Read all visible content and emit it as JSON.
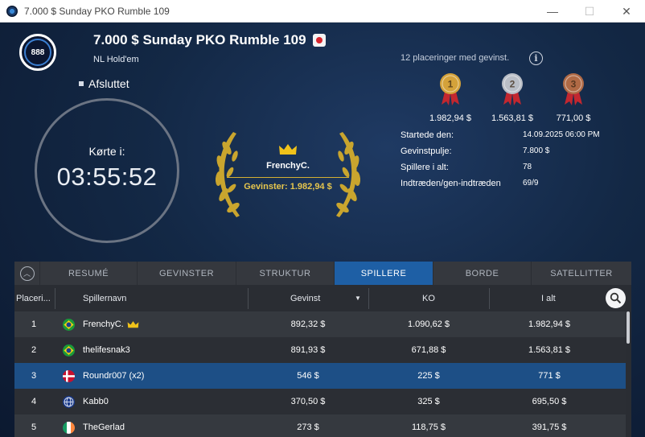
{
  "window": {
    "title": "7.000 $ Sunday PKO Rumble 109",
    "minimize": "—",
    "maximize": "☐",
    "close": "✕"
  },
  "tournament": {
    "logo_text": "888",
    "name": "7.000 $ Sunday PKO Rumble 109",
    "game_type": "NL Hold'em",
    "status": "Afsluttet"
  },
  "clock": {
    "label": "Kørte i:",
    "time": "03:55:52"
  },
  "winner": {
    "name": "FrenchyC.",
    "prize": "Gevinster: 1.982,94 $"
  },
  "payouts": {
    "header": "12 placeringer med gevinst.",
    "medals": [
      {
        "place": "1",
        "amount": "1.982,94 $",
        "color": "#d4a23a"
      },
      {
        "place": "2",
        "amount": "1.563,81 $",
        "color": "#b9bec6"
      },
      {
        "place": "3",
        "amount": "771,00 $",
        "color": "#b06a45"
      }
    ]
  },
  "stats": [
    {
      "label": "Startede den:",
      "value": "14.09.2025   06:00 PM"
    },
    {
      "label": "Gevinstpulje:",
      "value": "7.800 $"
    },
    {
      "label": "Spillere i alt:",
      "value": "78"
    },
    {
      "label": "Indtræden/gen-indtræden",
      "value": "69/9"
    }
  ],
  "tabs": [
    {
      "label": "RESUMÉ",
      "active": false
    },
    {
      "label": "GEVINSTER",
      "active": false
    },
    {
      "label": "STRUKTUR",
      "active": false
    },
    {
      "label": "SPILLERE",
      "active": true
    },
    {
      "label": "BORDE",
      "active": false
    },
    {
      "label": "SATELLITTER",
      "active": false
    }
  ],
  "table": {
    "headers": {
      "place": "Placeri...",
      "player": "Spillernavn",
      "winnings": "Gevinst",
      "sort_arrow": "▼",
      "ko": "KO",
      "total": "I alt"
    },
    "rows": [
      {
        "place": "1",
        "flag": "brazil",
        "name": "FrenchyC.",
        "crown": true,
        "winnings": "892,32 $",
        "ko": "1.090,62 $",
        "total": "1.982,94 $",
        "selected": false
      },
      {
        "place": "2",
        "flag": "brazil",
        "name": "thelifesnak3",
        "crown": false,
        "winnings": "891,93 $",
        "ko": "671,88 $",
        "total": "1.563,81 $",
        "selected": false
      },
      {
        "place": "3",
        "flag": "denmark",
        "name": "Roundr007 (x2)",
        "crown": false,
        "winnings": "546 $",
        "ko": "225 $",
        "total": "771 $",
        "selected": true
      },
      {
        "place": "4",
        "flag": "globe",
        "name": "Kabb0",
        "crown": false,
        "winnings": "370,50 $",
        "ko": "325 $",
        "total": "695,50 $",
        "selected": false
      },
      {
        "place": "5",
        "flag": "ireland",
        "name": "TheGerlad",
        "crown": false,
        "winnings": "273 $",
        "ko": "118,75 $",
        "total": "391,75 $",
        "selected": false
      }
    ]
  },
  "colors": {
    "accent": "#1e5fa5",
    "gold": "#e6c64d",
    "selected_row": "#1d4f86"
  }
}
